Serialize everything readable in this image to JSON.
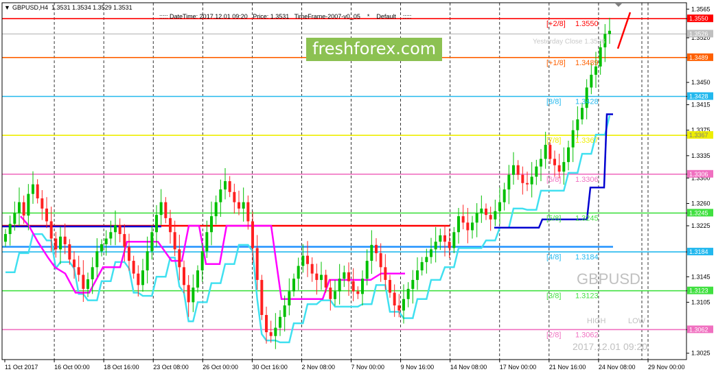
{
  "header": {
    "symbol_line": "GBPUSD,H4  1.3531 1.3534 1.3529 1.3531",
    "info_line": "::::: DateTime: 2017.12.01 09:20   Price: 1.3531   TimeFrame-2007-v0_05    *    Default    :::::"
  },
  "watermark": "freshforex.com",
  "labels": {
    "symbol_big": "GBPUSD",
    "high": "HIGH",
    "low": "LOW",
    "datetime": "2017.12.01 09:20",
    "yesterday_close": "Yesterday Close 1.3526"
  },
  "colors": {
    "background": "#ffffff",
    "bull": "#00c000",
    "bear": "#ff2020",
    "grid": "#000000",
    "cyan": "#40e0f0",
    "magenta": "#ff00ff",
    "blue": "#0000d0",
    "red_line": "#ff0000",
    "blue_level": "#1e90ff"
  },
  "chart_data": {
    "type": "candlestick",
    "symbol": "GBPUSD",
    "timeframe": "H4",
    "last_price": 1.3531,
    "ylim": [
      1.3015,
      1.3575
    ],
    "y_ticks": [
      1.3565,
      1.355,
      1.352,
      1.3489,
      1.345,
      1.3428,
      1.3415,
      1.3375,
      1.3367,
      1.3335,
      1.3306,
      1.33,
      1.326,
      1.3245,
      1.3225,
      1.3184,
      1.3145,
      1.3123,
      1.3105,
      1.3062,
      1.3025
    ],
    "x_ticks": [
      "11 Oct 2017",
      "16 Oct 00:00",
      "18 Oct 16:00",
      "23 Oct 08:00",
      "26 Oct 00:00",
      "30 Oct 16:00",
      "2 Nov 08:00",
      "7 Nov 00:00",
      "9 Nov 16:00",
      "14 Nov 08:00",
      "17 Nov 00:00",
      "21 Nov 16:00",
      "24 Nov 08:00",
      "29 Nov 00:00"
    ],
    "murrey_levels": [
      {
        "label": "[+2/8]",
        "price": 1.355,
        "color": "#ff0000",
        "price_label": "1.3550"
      },
      {
        "label": "[+1/8]",
        "price": 1.3489,
        "color": "#ff6000",
        "price_label": "1.3489"
      },
      {
        "label": "[8/8]",
        "price": 1.3428,
        "color": "#22b8ee",
        "price_label": "1.3428"
      },
      {
        "label": "[7/8]",
        "price": 1.3367,
        "color": "#eeee00",
        "price_label": "1.3367"
      },
      {
        "label": "[6/8]",
        "price": 1.3306,
        "color": "#f070c0",
        "price_label": "1.3306"
      },
      {
        "label": "[5/8]",
        "price": 1.3245,
        "color": "#40e040",
        "price_label": "1.3245"
      },
      {
        "label": "[4/8]",
        "price": 1.3184,
        "color": "#22b8ee",
        "price_label": "1.3184"
      },
      {
        "label": "[3/8]",
        "price": 1.3123,
        "color": "#40e040",
        "price_label": "1.3123"
      },
      {
        "label": "[2/8]",
        "price": 1.3062,
        "color": "#f070c0",
        "price_label": "1.3062"
      }
    ],
    "close_series": [
      1.3212,
      1.3228,
      1.3245,
      1.3262,
      1.3241,
      1.3275,
      1.329,
      1.3268,
      1.3252,
      1.3232,
      1.3205,
      1.3188,
      1.3208,
      1.3196,
      1.3172,
      1.316,
      1.3148,
      1.3126,
      1.3141,
      1.316,
      1.3185,
      1.3196,
      1.3205,
      1.3215,
      1.3226,
      1.3212,
      1.3192,
      1.317,
      1.315,
      1.3132,
      1.3155,
      1.3185,
      1.3215,
      1.3242,
      1.3262,
      1.3237,
      1.3215,
      1.3188,
      1.316,
      1.3132,
      1.3105,
      1.3128,
      1.3155,
      1.3185,
      1.3215,
      1.324,
      1.3262,
      1.3282,
      1.3295,
      1.3278,
      1.3262,
      1.3252,
      1.3262,
      1.3232,
      1.319,
      1.314,
      1.3085,
      1.3058,
      1.3052,
      1.3065,
      1.3082,
      1.31,
      1.3122,
      1.3142,
      1.3162,
      1.3178,
      1.3165,
      1.315,
      1.314,
      1.3148,
      1.3128,
      1.311,
      1.3122,
      1.3142,
      1.3152,
      1.3138,
      1.3122,
      1.3118,
      1.3142,
      1.317,
      1.3195,
      1.3182,
      1.316,
      1.314,
      1.312,
      1.31,
      1.3092,
      1.311,
      1.3126,
      1.314,
      1.3155,
      1.3168,
      1.3176,
      1.3188,
      1.32,
      1.321,
      1.32,
      1.319,
      1.3215,
      1.324,
      1.323,
      1.3218,
      1.323,
      1.3245,
      1.3252,
      1.3242,
      1.3235,
      1.3248,
      1.3262,
      1.3282,
      1.3305,
      1.332,
      1.3305,
      1.3292,
      1.329,
      1.3302,
      1.3318,
      1.333,
      1.3352,
      1.333,
      1.332,
      1.331,
      1.3325,
      1.3348,
      1.3375,
      1.3392,
      1.341,
      1.3442,
      1.3462,
      1.3475,
      1.3505,
      1.3526,
      1.3531
    ],
    "indicator_lines": [
      {
        "name": "cyan trailing",
        "color": "#40e0f0"
      },
      {
        "name": "magenta step",
        "color": "#ff00ff"
      },
      {
        "name": "blue step",
        "color": "#0000d0"
      },
      {
        "name": "red horizontal",
        "color": "#ff0000",
        "price": 1.3225
      },
      {
        "name": "blue horizontal",
        "color": "#1e90ff",
        "price": 1.3192
      }
    ]
  }
}
